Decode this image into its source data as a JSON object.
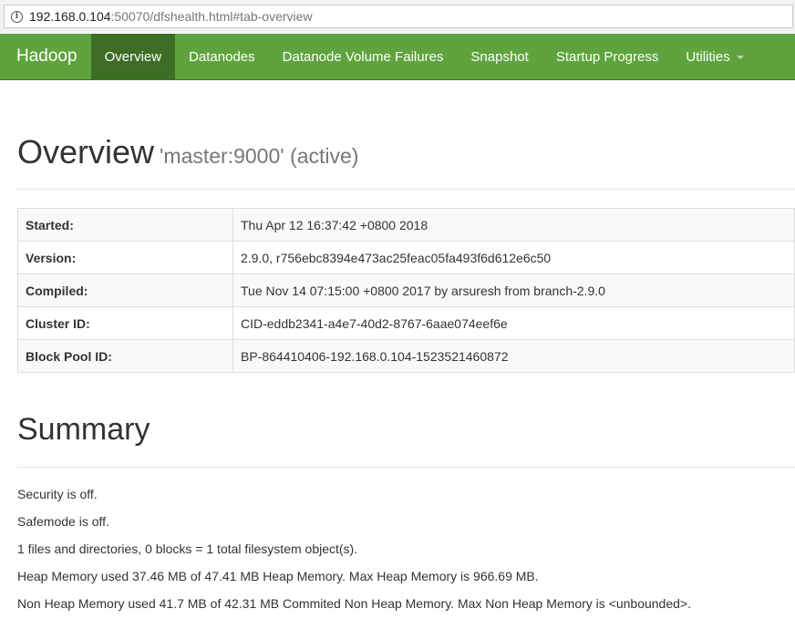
{
  "browser": {
    "url_host": "192.168.0.104",
    "url_rest": ":50070/dfshealth.html#tab-overview"
  },
  "navbar": {
    "brand": "Hadoop",
    "items": [
      {
        "label": "Overview"
      },
      {
        "label": "Datanodes"
      },
      {
        "label": "Datanode Volume Failures"
      },
      {
        "label": "Snapshot"
      },
      {
        "label": "Startup Progress"
      },
      {
        "label": "Utilities"
      }
    ],
    "active_index": 0,
    "colors": {
      "bar": "#5fa33e",
      "active": "#3e6e26"
    }
  },
  "overview": {
    "title": "Overview",
    "subtitle": "'master:9000' (active)",
    "rows": [
      {
        "key": "Started:",
        "value": "Thu Apr 12 16:37:42 +0800 2018"
      },
      {
        "key": "Version:",
        "value": "2.9.0, r756ebc8394e473ac25feac05fa493f6d612e6c50"
      },
      {
        "key": "Compiled:",
        "value": "Tue Nov 14 07:15:00 +0800 2017 by arsuresh from branch-2.9.0"
      },
      {
        "key": "Cluster ID:",
        "value": "CID-eddb2341-a4e7-40d2-8767-6aae074eef6e"
      },
      {
        "key": "Block Pool ID:",
        "value": "BP-864410406-192.168.0.104-1523521460872"
      }
    ]
  },
  "summary": {
    "title": "Summary",
    "lines": [
      "Security is off.",
      "Safemode is off.",
      "1 files and directories, 0 blocks = 1 total filesystem object(s).",
      "Heap Memory used 37.46 MB of 47.41 MB Heap Memory. Max Heap Memory is 966.69 MB.",
      "Non Heap Memory used 41.7 MB of 42.31 MB Commited Non Heap Memory. Max Non Heap Memory is <unbounded>."
    ]
  }
}
